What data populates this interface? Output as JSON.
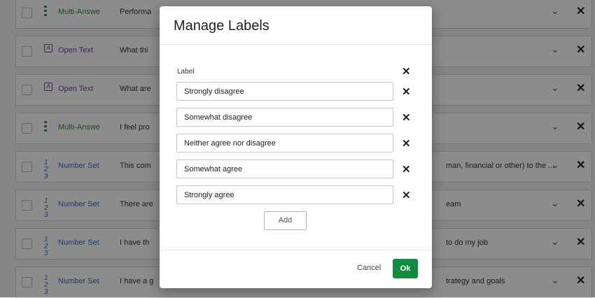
{
  "background_rows": [
    {
      "type_label": "Multi-Answe",
      "type_style": "green",
      "icon": "multi-answer-icon",
      "question": "Performa",
      "right_text": ""
    },
    {
      "type_label": "Open Text",
      "type_style": "purple",
      "icon": "open-text-icon",
      "question": "What thi",
      "right_text": ""
    },
    {
      "type_label": "Open Text",
      "type_style": "purple",
      "icon": "open-text-icon",
      "question": "What are",
      "right_text": ""
    },
    {
      "type_label": "Multi-Answe",
      "type_style": "green",
      "icon": "multi-answer-icon",
      "question": "I feel pro",
      "right_text": ""
    },
    {
      "type_label": "Number Set",
      "type_style": "blue",
      "icon": "number-set-icon",
      "question": "This com",
      "right_text": "man, financial or other) to the ..."
    },
    {
      "type_label": "Number Set",
      "type_style": "blue",
      "icon": "number-set-icon",
      "question": "There are",
      "right_text": "eam"
    },
    {
      "type_label": "Number Set",
      "type_style": "blue",
      "icon": "number-set-icon",
      "question": "I have th",
      "right_text": "to do my job"
    },
    {
      "type_label": "Number Set",
      "type_style": "blue",
      "icon": "number-set-icon",
      "question": "I have a g",
      "right_text": "trategy and goals"
    }
  ],
  "modal": {
    "title": "Manage Labels",
    "column_header": "Label",
    "labels": [
      "Strongly disagree",
      "Somewhat disagree",
      "Neither agree nor disagree",
      "Somewhat agree",
      "Strongly agree"
    ],
    "add_label": "Add",
    "cancel_label": "Cancel",
    "ok_label": "Ok"
  },
  "colors": {
    "ok_button": "#138a3f",
    "multi_answer": "#2e8b3a",
    "open_text": "#7b3fa0",
    "number_set": "#2a6fd1"
  }
}
